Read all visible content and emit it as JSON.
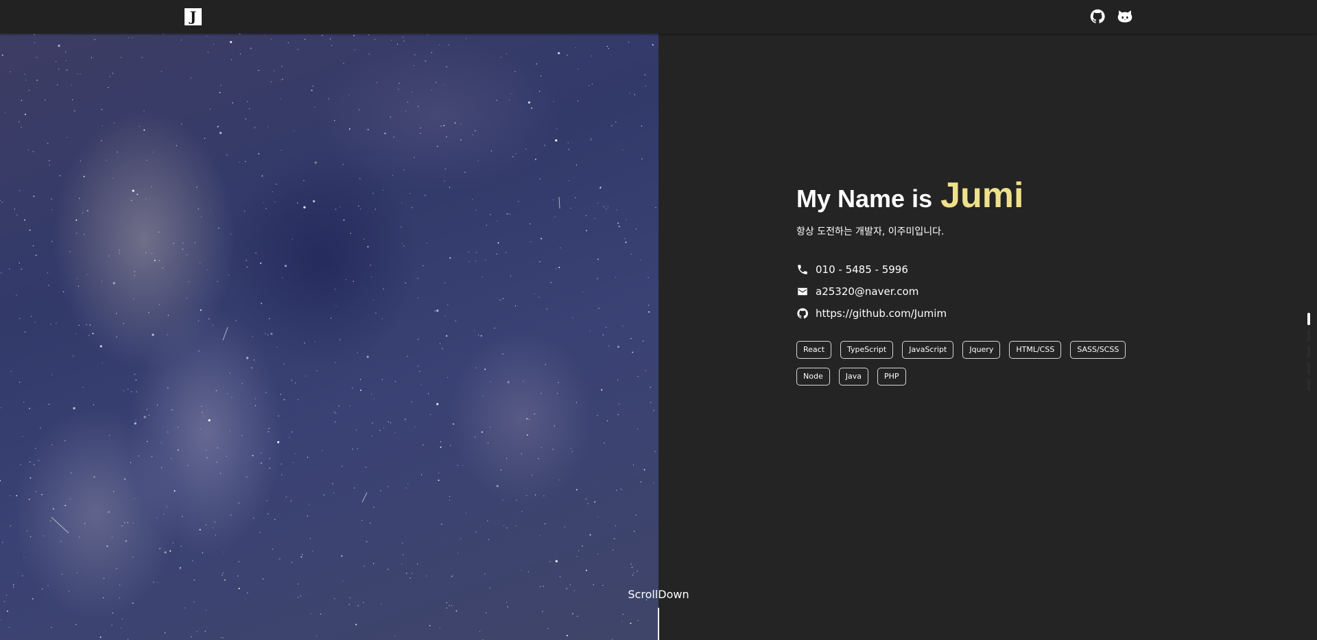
{
  "header": {
    "logo_letter": "J",
    "icons": [
      "github-icon",
      "octocat-icon"
    ]
  },
  "hero_image": {
    "subject": "starry-night-sky"
  },
  "intro": {
    "heading_prefix": "My Name is",
    "heading_name": "Jumi",
    "tagline": "항상 도전하는 개발자, 이주미입니다.",
    "contacts": [
      {
        "icon": "phone-icon",
        "text": "010 - 5485 - 5996"
      },
      {
        "icon": "mail-icon",
        "text": "a25320@naver.com"
      },
      {
        "icon": "github-icon",
        "text": "https://github.com/Jumim"
      }
    ],
    "skills": [
      "React",
      "TypeScript",
      "JavaScript",
      "Jquery",
      "HTML/CSS",
      "SASS/SCSS",
      "Node",
      "Java",
      "PHP"
    ]
  },
  "scroll": {
    "label": "ScrollDown"
  },
  "pagination": {
    "count": 5,
    "active": 1
  },
  "colors": {
    "background": "#242424",
    "header": "#222222",
    "accent": "#efe08b",
    "text": "#ffffff"
  }
}
